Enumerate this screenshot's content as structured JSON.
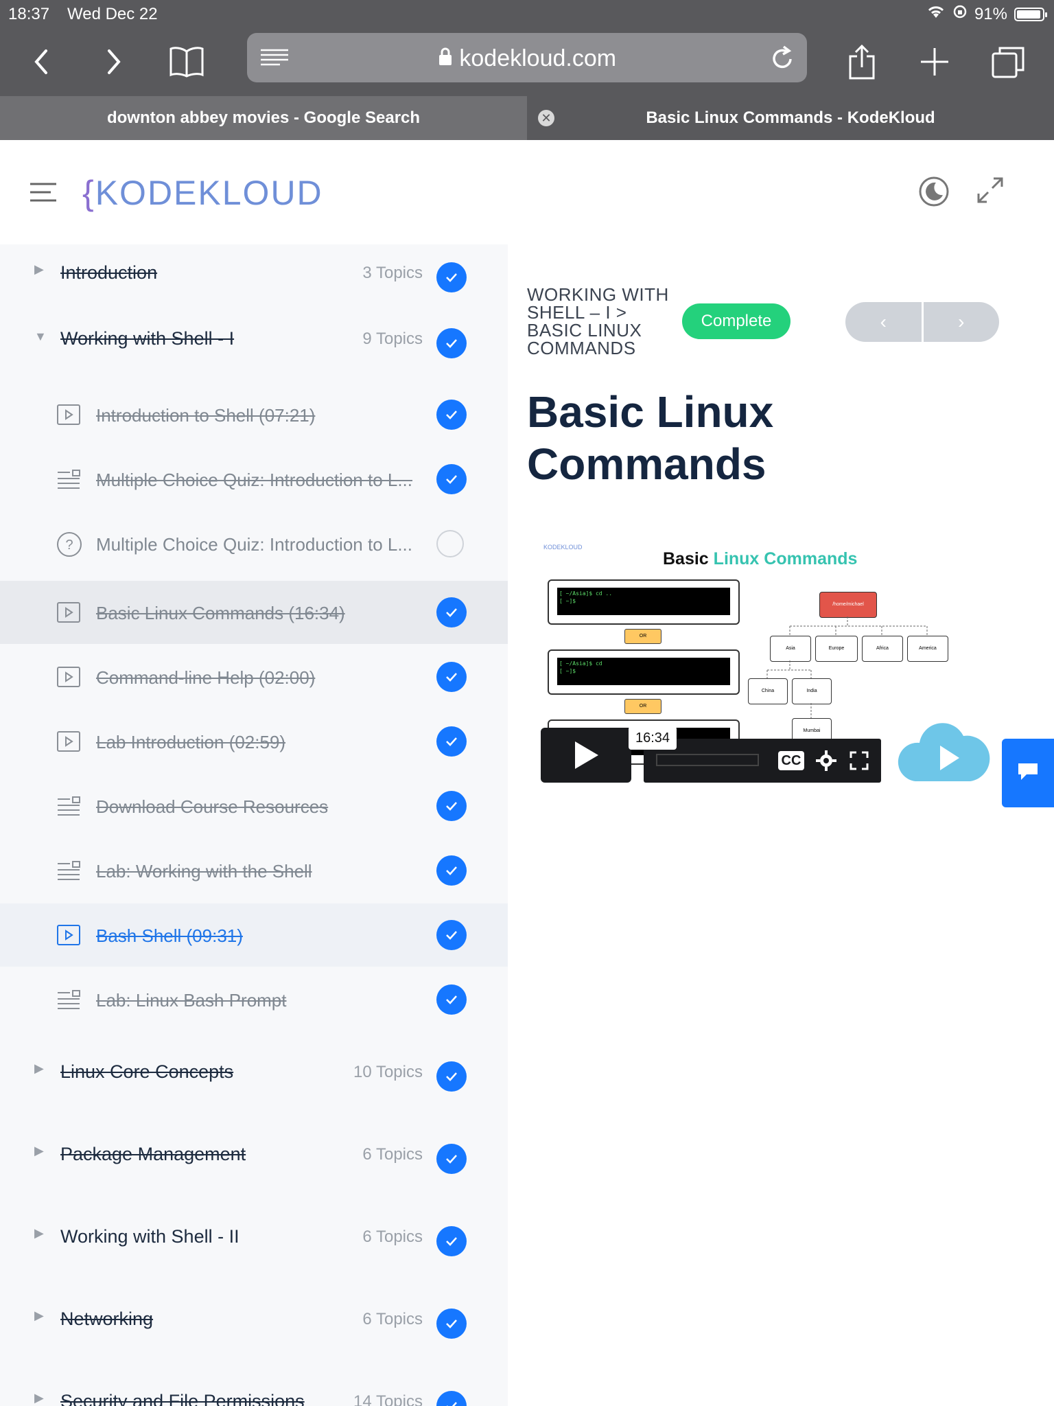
{
  "status": {
    "time": "18:37",
    "date": "Wed Dec 22",
    "battery": "91%"
  },
  "browser": {
    "url_host": "kodekloud.com",
    "tabs": [
      {
        "label": "downton abbey movies - Google Search"
      },
      {
        "label": "Basic Linux Commands - KodeKloud"
      }
    ]
  },
  "site": {
    "logo": "KODEKLOUD"
  },
  "sidebar": {
    "sections": [
      {
        "title": "Introduction",
        "topics": "3 Topics"
      },
      {
        "title": "Working with Shell - I",
        "topics": "9 Topics"
      },
      {
        "title": "Linux Core Concepts",
        "topics": "10 Topics"
      },
      {
        "title": "Package Management",
        "topics": "6 Topics"
      },
      {
        "title": "Working with Shell - II",
        "topics": "6 Topics"
      },
      {
        "title": "Networking",
        "topics": "6 Topics"
      },
      {
        "title": "Security and File Permissions",
        "topics": "14 Topics"
      }
    ],
    "lessons": [
      {
        "title": "Introduction to Shell (07:21)"
      },
      {
        "title": "Multiple Choice Quiz: Introduction to L..."
      },
      {
        "title": "Multiple Choice Quiz: Introduction to L..."
      },
      {
        "title": "Basic Linux Commands (16:34)"
      },
      {
        "title": "Command-line Help (02:00)"
      },
      {
        "title": "Lab Introduction (02:59)"
      },
      {
        "title": "Download Course Resources"
      },
      {
        "title": "Lab: Working with the Shell"
      },
      {
        "title": "Bash Shell (09:31)"
      },
      {
        "title": "Lab: Linux Bash Prompt"
      }
    ]
  },
  "main": {
    "breadcrumb": "WORKING WITH SHELL – I > BASIC LINUX COMMANDS",
    "complete_label": "Complete",
    "title": "Basic Linux Commands",
    "prev_label": "‹",
    "next_label": "›"
  },
  "video": {
    "logo": "KODEKLOUD",
    "title_part1": "Basic ",
    "title_part2": "Linux Commands",
    "terminal_1": "[ ~/Asia]$ cd ..\n[ ~]$",
    "terminal_2": "[ ~/Asia]$ cd\n[ ~]$",
    "or_label": "OR",
    "tree_root": "/home/michael",
    "tree_nodes": [
      "Asia",
      "Europe",
      "Africa",
      "America",
      "China",
      "India",
      "Mumbai"
    ],
    "duration_tooltip": "16:34",
    "cc_label": "CC"
  }
}
